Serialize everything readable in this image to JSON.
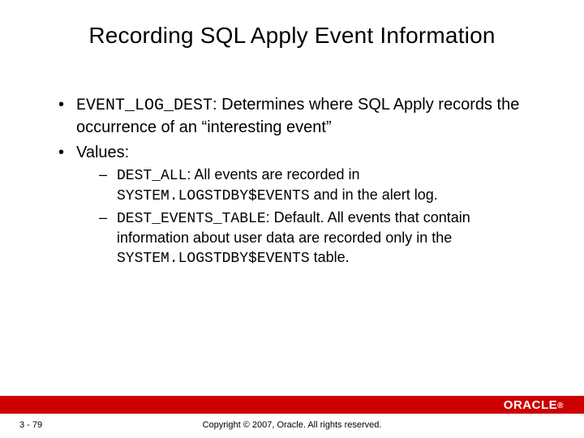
{
  "title": "Recording SQL Apply Event Information",
  "bullets": {
    "b1": {
      "code": "EVENT_LOG_DEST",
      "rest": ": Determines where SQL Apply records the occurrence of an “interesting event”"
    },
    "b2": {
      "label": "Values:",
      "sub1": {
        "code1": "DEST_ALL",
        "t1": ": All events are recorded in ",
        "code2": "SYSTEM.LOGSTDBY$EVENTS",
        "t2": " and in the alert log."
      },
      "sub2": {
        "code1": "DEST_EVENTS_TABLE",
        "t1": ": Default. All events that contain information about user data are recorded only in the ",
        "code2": "SYSTEM.LOGSTDBY$EVENTS",
        "t2": " table."
      }
    }
  },
  "footer": {
    "pageNumber": "3 - 79",
    "copyright": "Copyright © 2007, Oracle. All rights reserved.",
    "logo": "ORACLE"
  }
}
